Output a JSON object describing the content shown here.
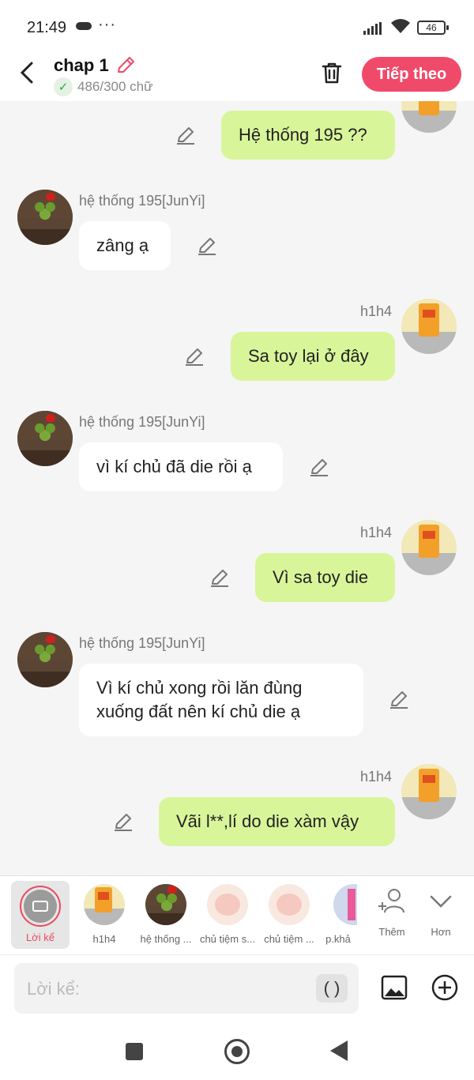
{
  "status": {
    "time": "21:49",
    "battery": "46"
  },
  "header": {
    "title": "chap 1",
    "word_count": "486/300 chữ",
    "next_label": "Tiếp theo"
  },
  "messages": [
    {
      "side": "right",
      "text": "Hệ thống 195 ??"
    },
    {
      "side": "left",
      "sender": "hệ thống 195[JunYi]",
      "text": "zâng ạ"
    },
    {
      "side": "right",
      "sender": "h1h4",
      "text": "Sa toy lại ở đây"
    },
    {
      "side": "left",
      "sender": "hệ thống 195[JunYi]",
      "text": "vì kí chủ đã die rồi ạ"
    },
    {
      "side": "right",
      "sender": "h1h4",
      "text": "Vì sa toy die"
    },
    {
      "side": "left",
      "sender": "hệ thống 195[JunYi]",
      "text": "Vì kí chủ xong rồi lăn đùng xuống đất nên kí chủ die ạ"
    },
    {
      "side": "right",
      "sender": "h1h4",
      "text": "Vãi l**,lí do die xàm vậy"
    }
  ],
  "characters": [
    {
      "label": "Lời kể"
    },
    {
      "label": "h1h4"
    },
    {
      "label": "hệ thống ..."
    },
    {
      "label": "chủ tiệm s..."
    },
    {
      "label": "chủ tiệm ..."
    },
    {
      "label": "p.khả"
    }
  ],
  "actions": {
    "add_label": "Thêm",
    "more_label": "Hơn"
  },
  "input": {
    "placeholder": "Lời kể:",
    "paren_label": "( )"
  },
  "colors": {
    "accent": "#f04a6a",
    "right_bubble": "#d9f59a",
    "left_bubble": "#ffffff"
  }
}
